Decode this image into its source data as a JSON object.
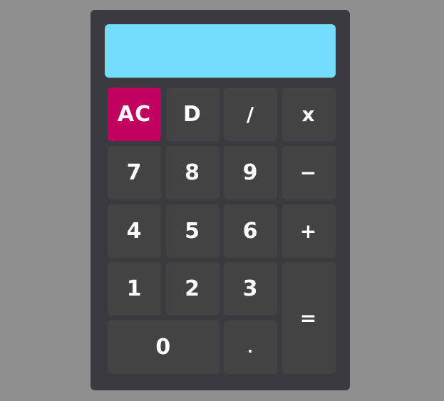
{
  "display": {
    "value": ""
  },
  "keys": {
    "clear": "AC",
    "delete": "D",
    "divide": "/",
    "multiply": "x",
    "seven": "7",
    "eight": "8",
    "nine": "9",
    "subtract": "−",
    "four": "4",
    "five": "5",
    "six": "6",
    "add": "+",
    "one": "1",
    "two": "2",
    "three": "3",
    "equals": "=",
    "zero": "0",
    "decimal": "."
  },
  "colors": {
    "background": "#8f8f8f",
    "body": "#3b3b3f",
    "display": "#74dcff",
    "key": "#434343",
    "clear_key": "#c2005f",
    "key_text": "#ffffff"
  }
}
